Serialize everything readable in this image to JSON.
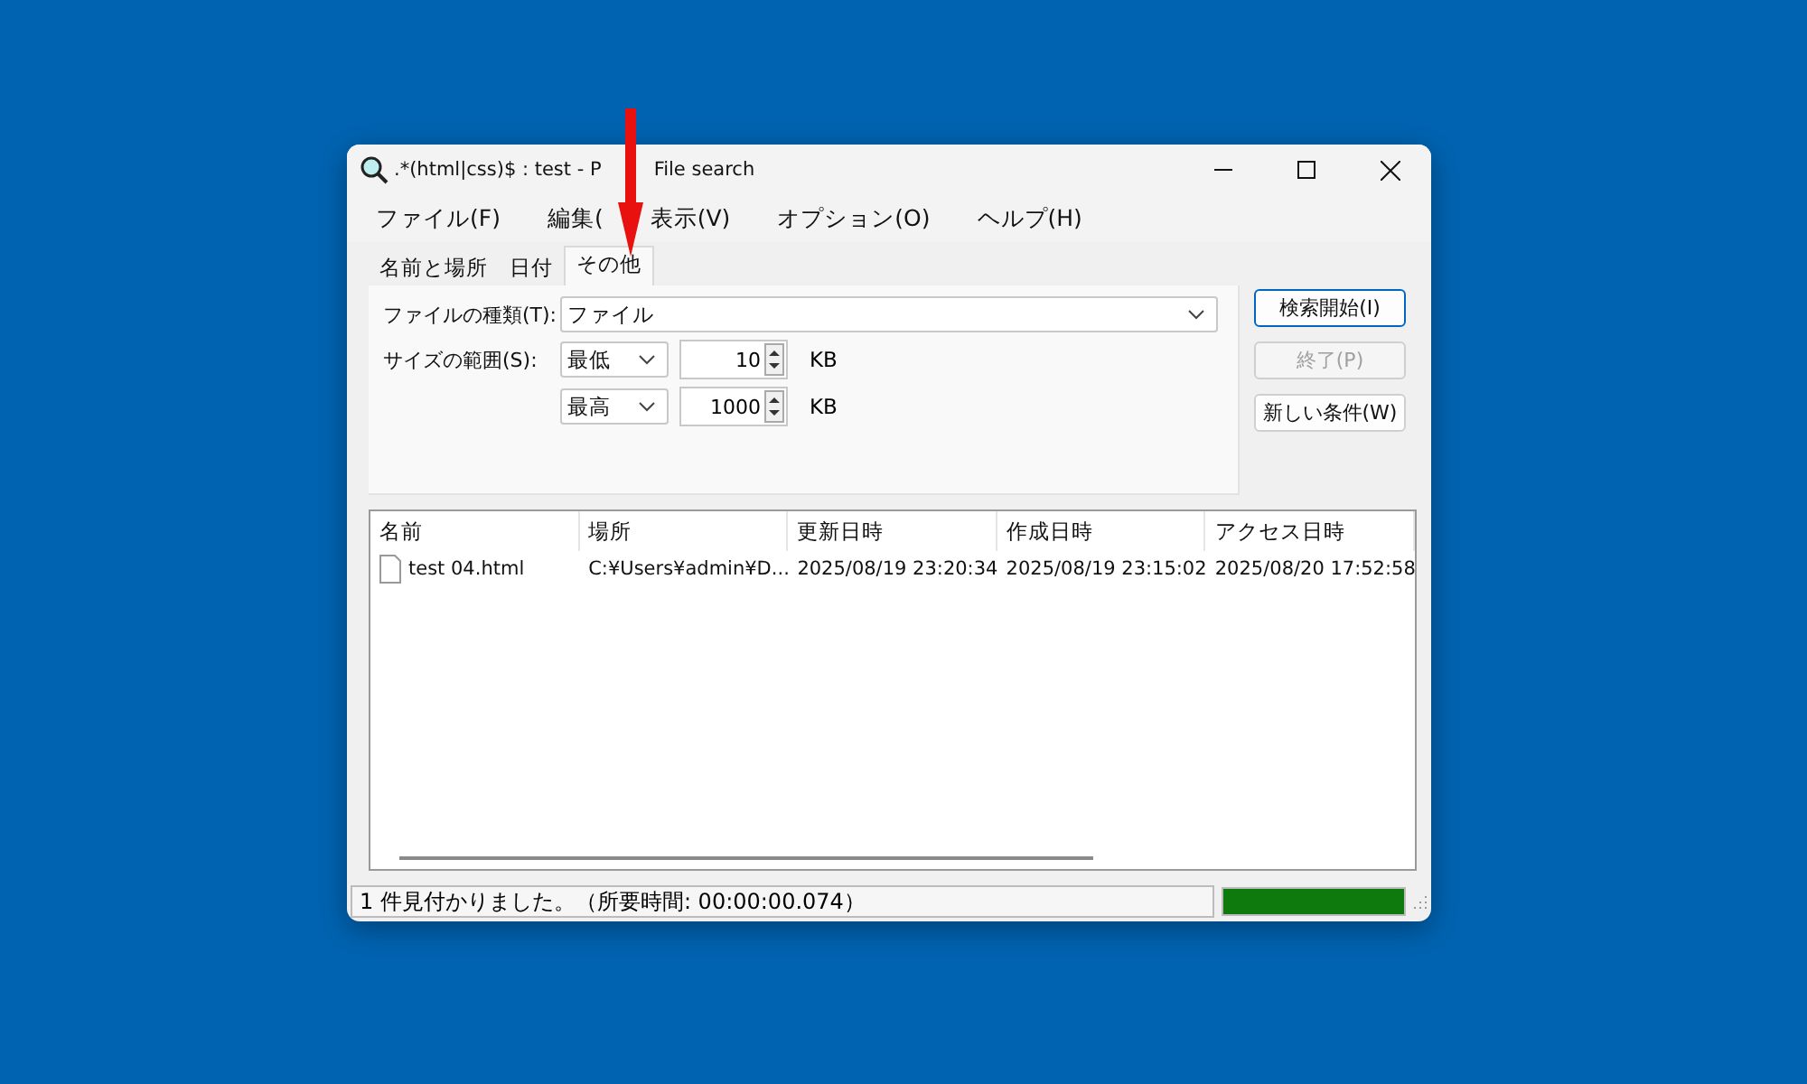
{
  "window": {
    "title_parts": [
      ".*(html|css)$ : test - P",
      "File search"
    ]
  },
  "menu": [
    "ファイル(F)",
    "編集(",
    "表示(V)",
    "オプション(O)",
    "ヘルプ(H)"
  ],
  "tabs": [
    {
      "label": "名前と場所",
      "selected": false
    },
    {
      "label": "日付",
      "selected": false
    },
    {
      "label": "その他",
      "selected": true
    }
  ],
  "form": {
    "file_type_label": "ファイルの種類(T):",
    "file_type_value": "ファイル",
    "size_label": "サイズの範囲(S):",
    "sizes": [
      {
        "mode": "最低",
        "value": "10",
        "unit": "KB"
      },
      {
        "mode": "最高",
        "value": "1000",
        "unit": "KB"
      }
    ]
  },
  "buttons": [
    {
      "label": "検索開始(I)",
      "disabled": false,
      "default": true
    },
    {
      "label": "終了(P)",
      "disabled": true,
      "default": false
    },
    {
      "label": "新しい条件(W)",
      "disabled": false,
      "default": false
    }
  ],
  "table": {
    "columns": [
      "名前",
      "場所",
      "更新日時",
      "作成日時",
      "アクセス日時"
    ],
    "rows": [
      [
        "test 04.html",
        "C:¥Users¥admin¥D...",
        "2025/08/19 23:20:34",
        "2025/08/19 23:15:02",
        "2025/08/20 17:52:58"
      ]
    ]
  },
  "status_bar": {
    "text": "1 件見付かりました。（所要時間: 00:00:00.074）",
    "progress": {
      "level": 1
    }
  }
}
